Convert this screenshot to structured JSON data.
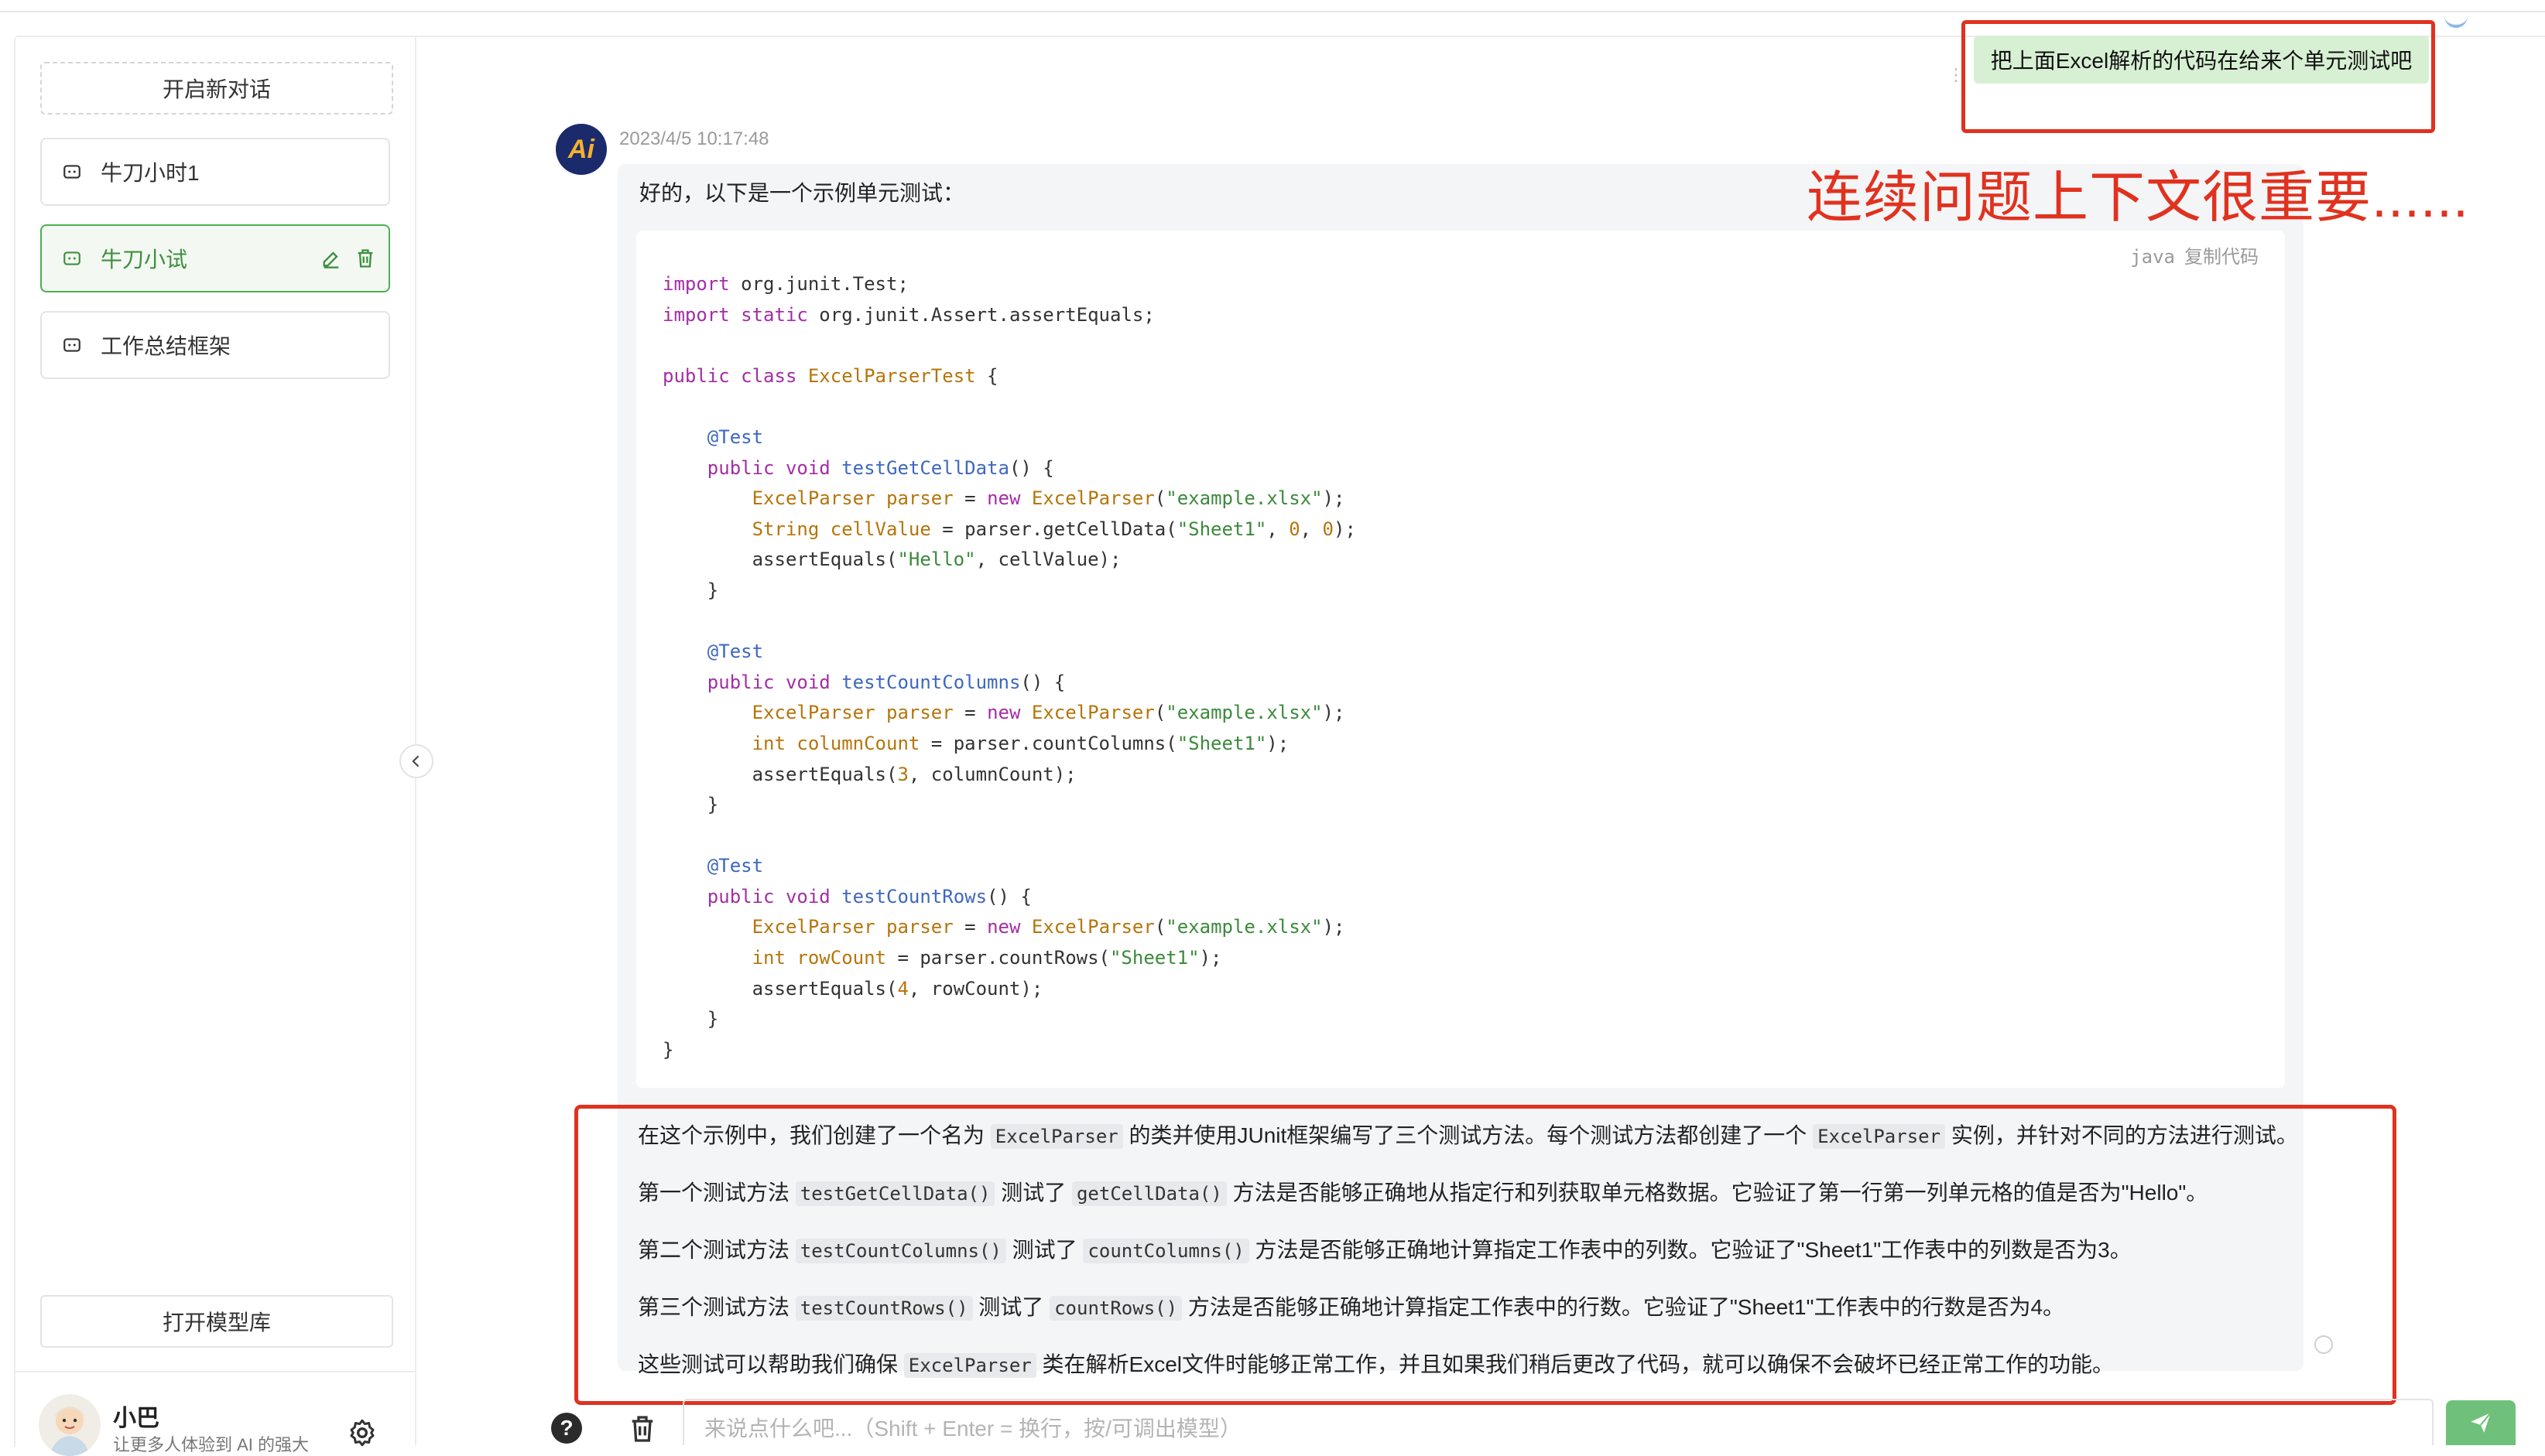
{
  "sidebar": {
    "new_chat_label": "开启新对话",
    "sessions": [
      {
        "label": "牛刀小时1"
      },
      {
        "label": "牛刀小试"
      },
      {
        "label": "工作总结框架"
      }
    ],
    "open_models_label": "打开模型库",
    "user": {
      "name": "小巴",
      "subtitle": "让更多人体验到 AI 的强大"
    }
  },
  "chat": {
    "user_message": "把上面Excel解析的代码在给来个单元测试吧",
    "bot": {
      "avatar_text": "Ai",
      "timestamp": "2023/4/5 10:17:48",
      "intro": "好的，以下是一个示例单元测试：",
      "code_lang": "java",
      "copy_label": "复制代码",
      "paragraphs": [
        {
          "parts": [
            "在这个示例中，我们创建了一个名为 ",
            "ExcelParser",
            " 的类并使用JUnit框架编写了三个测试方法。每个测试方法都创建了一个 ",
            "ExcelParser",
            " 实例，并针对不同的方法进行测试。"
          ]
        },
        {
          "parts": [
            "第一个测试方法 ",
            "testGetCellData()",
            " 测试了 ",
            "getCellData()",
            " 方法是否能够正确地从指定行和列获取单元格数据。它验证了第一行第一列单元格的值是否为\"Hello\"。"
          ]
        },
        {
          "parts": [
            "第二个测试方法 ",
            "testCountColumns()",
            " 测试了 ",
            "countColumns()",
            " 方法是否能够正确地计算指定工作表中的列数。它验证了\"Sheet1\"工作表中的列数是否为3。"
          ]
        },
        {
          "parts": [
            "第三个测试方法 ",
            "testCountRows()",
            " 测试了 ",
            "countRows()",
            " 方法是否能够正确地计算指定工作表中的行数。它验证了\"Sheet1\"工作表中的行数是否为4。"
          ]
        },
        {
          "parts": [
            "这些测试可以帮助我们确保 ",
            "ExcelParser",
            " 类在解析Excel文件时能够正常工作，并且如果我们稍后更改了代码，就可以确保不会破坏已经正常工作的功能。"
          ]
        }
      ]
    }
  },
  "annotation": {
    "text": "连续问题上下文很重要......",
    "color": "#e0321f"
  },
  "input": {
    "placeholder": "来说点什么吧...（Shift + Enter = 换行，按/可调出模型）"
  },
  "colors": {
    "accent": "#4caf50",
    "user_bubble": "#d7f0d3",
    "send_button": "#6fc07a",
    "annotation": "#e0321f"
  },
  "icons": [
    "chat-icon",
    "edit-icon",
    "delete-icon",
    "gear-icon",
    "chevron-left-icon",
    "help-icon",
    "trash-icon",
    "send-icon"
  ]
}
